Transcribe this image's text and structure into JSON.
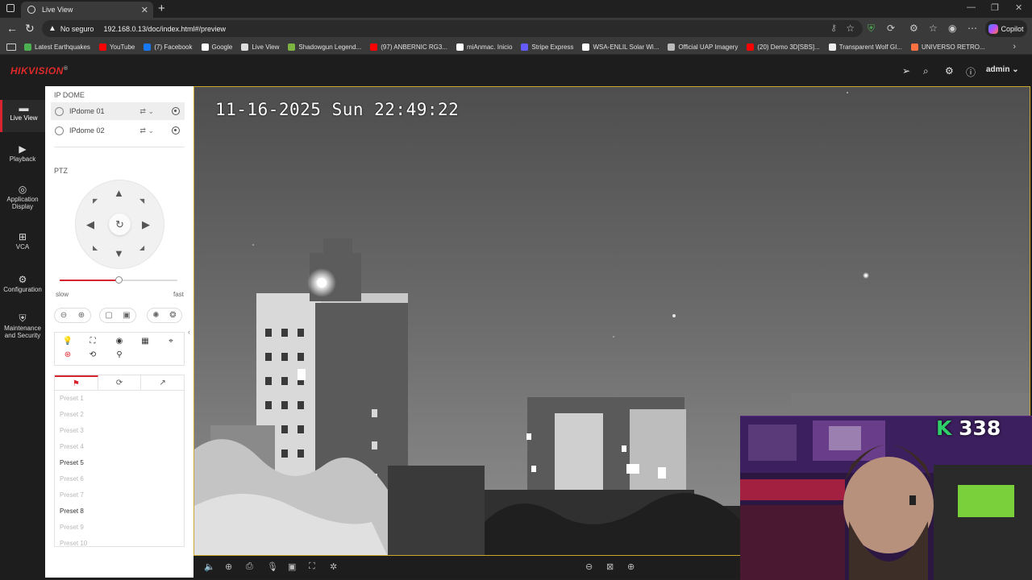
{
  "browser": {
    "tab_title": "Live View",
    "insecure_label": "No seguro",
    "url": "192.168.0.13/doc/index.html#/preview",
    "copilot_label": "Copilot"
  },
  "bookmarks": [
    {
      "label": "Latest Earthquakes",
      "color": "#4caf50"
    },
    {
      "label": "YouTube",
      "color": "#ff0000"
    },
    {
      "label": "(7) Facebook",
      "color": "#1877f2"
    },
    {
      "label": "Google",
      "color": "#ffffff"
    },
    {
      "label": "Live View",
      "color": "#dddddd"
    },
    {
      "label": "Shadowgun Legend...",
      "color": "#7cb342"
    },
    {
      "label": "(97) ANBERNIC RG3...",
      "color": "#ff0000"
    },
    {
      "label": "miAnmac. Inicio",
      "color": "#ffffff"
    },
    {
      "label": "Stripe Express",
      "color": "#635bff"
    },
    {
      "label": "WSA-ENLIL Solar Wi...",
      "color": "#ffffff"
    },
    {
      "label": "Official UAP Imagery",
      "color": "#bbbbbb"
    },
    {
      "label": "(20) Demo 3D[SBS]...",
      "color": "#ff0000"
    },
    {
      "label": "Transparent Wolf GI...",
      "color": "#eeeeee"
    },
    {
      "label": "UNIVERSO RETRO...",
      "color": "#ff7043"
    }
  ],
  "app": {
    "brand": "HIKVISION",
    "brand_color": "#e02a2a",
    "user": "admin"
  },
  "nav": [
    {
      "label": "Live View",
      "icon": "monitor-icon"
    },
    {
      "label": "Playback",
      "icon": "play-icon"
    },
    {
      "label": "Application Display",
      "icon": "app-icon"
    },
    {
      "label": "VCA",
      "icon": "grid-icon"
    },
    {
      "label": "Configuration",
      "icon": "gear-icon"
    },
    {
      "label": "Maintenance and Security",
      "icon": "shield-icon"
    }
  ],
  "panel": {
    "group_title": "IP DOME",
    "cameras": [
      "IPdome 01",
      "IPdome 02"
    ],
    "ptz_title": "PTZ",
    "speed_slow": "slow",
    "speed_fast": "fast",
    "speed_level": 0.5,
    "presets": [
      {
        "label": "Preset 1",
        "set": false
      },
      {
        "label": "Preset 2",
        "set": false
      },
      {
        "label": "Preset 3",
        "set": false
      },
      {
        "label": "Preset 4",
        "set": false
      },
      {
        "label": "Preset 5",
        "set": true
      },
      {
        "label": "Preset 6",
        "set": false
      },
      {
        "label": "Preset 7",
        "set": false
      },
      {
        "label": "Preset 8",
        "set": true
      },
      {
        "label": "Preset 9",
        "set": false
      },
      {
        "label": "Preset 10",
        "set": false
      }
    ]
  },
  "video": {
    "osd_timestamp": "11-16-2025 Sun 22:49:22"
  },
  "overlay": {
    "k_letter": "K",
    "count": "338"
  }
}
